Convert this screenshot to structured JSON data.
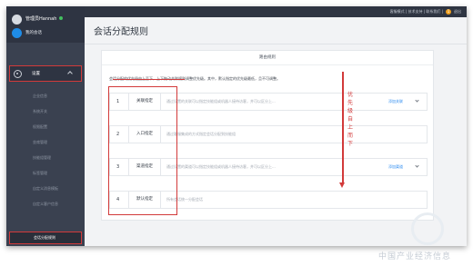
{
  "topbar": {
    "links": "客服模式 | 技术支持 | 联系我们 |",
    "notification_count": "1",
    "extra": "退出"
  },
  "sidebar": {
    "user_name": "管理员Hannah",
    "session_label": "我的会话",
    "settings_label": "设置",
    "menu": [
      "企业信息",
      "系统开关",
      "权限配置",
      "坐席管理",
      "技能组管理",
      "标签管理",
      "自定义消息模板",
      "自定义客户信息"
    ],
    "active_item": "会话分配规则"
  },
  "page": {
    "title": "会话分配规则"
  },
  "card": {
    "header": "路由规则",
    "description": "会话分配的优先级由上至下，上下拖动关联规则调整优先级。其中，默认指定的优先级最低，且不可调整。",
    "rules": [
      {
        "num": "1",
        "name": "关联指定",
        "desc": "通过设置的关联可以指定技能组或机器人接待访客，并可以区分上...",
        "link": "添加关联",
        "has_chevron": true
      },
      {
        "num": "2",
        "name": "入口指定",
        "desc": "通过客服集成的方式指定会话分配到技能组",
        "link": "",
        "has_chevron": false
      },
      {
        "num": "3",
        "name": "渠道指定",
        "desc": "通过设置的渠道可以指定技能组或机器人接待访客，并可以区分上...",
        "link": "添加渠道",
        "has_chevron": true
      },
      {
        "num": "4",
        "name": "默认指定",
        "desc": "所有会话统一分配会话",
        "link": "",
        "has_chevron": false
      }
    ]
  },
  "annotation": {
    "text": "优先级自上而下",
    "color": "#d23a3a"
  },
  "watermark": {
    "text": "中国产业经济信息"
  },
  "colors": {
    "sidebar": "#3a4150",
    "accent": "#2d8cf0",
    "annotation": "#d23a3a"
  }
}
